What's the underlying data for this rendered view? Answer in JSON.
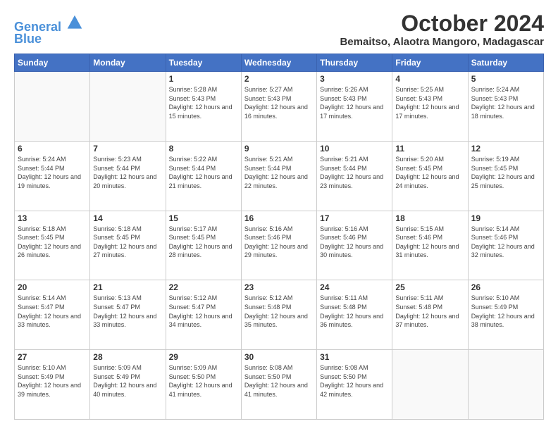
{
  "logo": {
    "line1": "General",
    "line2": "Blue"
  },
  "title": "October 2024",
  "subtitle": "Bemaitso, Alaotra Mangoro, Madagascar",
  "weekdays": [
    "Sunday",
    "Monday",
    "Tuesday",
    "Wednesday",
    "Thursday",
    "Friday",
    "Saturday"
  ],
  "weeks": [
    [
      null,
      null,
      {
        "day": "1",
        "sunrise": "5:28 AM",
        "sunset": "5:43 PM",
        "daylight": "12 hours and 15 minutes."
      },
      {
        "day": "2",
        "sunrise": "5:27 AM",
        "sunset": "5:43 PM",
        "daylight": "12 hours and 16 minutes."
      },
      {
        "day": "3",
        "sunrise": "5:26 AM",
        "sunset": "5:43 PM",
        "daylight": "12 hours and 17 minutes."
      },
      {
        "day": "4",
        "sunrise": "5:25 AM",
        "sunset": "5:43 PM",
        "daylight": "12 hours and 17 minutes."
      },
      {
        "day": "5",
        "sunrise": "5:24 AM",
        "sunset": "5:43 PM",
        "daylight": "12 hours and 18 minutes."
      }
    ],
    [
      {
        "day": "6",
        "sunrise": "5:24 AM",
        "sunset": "5:44 PM",
        "daylight": "12 hours and 19 minutes."
      },
      {
        "day": "7",
        "sunrise": "5:23 AM",
        "sunset": "5:44 PM",
        "daylight": "12 hours and 20 minutes."
      },
      {
        "day": "8",
        "sunrise": "5:22 AM",
        "sunset": "5:44 PM",
        "daylight": "12 hours and 21 minutes."
      },
      {
        "day": "9",
        "sunrise": "5:21 AM",
        "sunset": "5:44 PM",
        "daylight": "12 hours and 22 minutes."
      },
      {
        "day": "10",
        "sunrise": "5:21 AM",
        "sunset": "5:44 PM",
        "daylight": "12 hours and 23 minutes."
      },
      {
        "day": "11",
        "sunrise": "5:20 AM",
        "sunset": "5:45 PM",
        "daylight": "12 hours and 24 minutes."
      },
      {
        "day": "12",
        "sunrise": "5:19 AM",
        "sunset": "5:45 PM",
        "daylight": "12 hours and 25 minutes."
      }
    ],
    [
      {
        "day": "13",
        "sunrise": "5:18 AM",
        "sunset": "5:45 PM",
        "daylight": "12 hours and 26 minutes."
      },
      {
        "day": "14",
        "sunrise": "5:18 AM",
        "sunset": "5:45 PM",
        "daylight": "12 hours and 27 minutes."
      },
      {
        "day": "15",
        "sunrise": "5:17 AM",
        "sunset": "5:45 PM",
        "daylight": "12 hours and 28 minutes."
      },
      {
        "day": "16",
        "sunrise": "5:16 AM",
        "sunset": "5:46 PM",
        "daylight": "12 hours and 29 minutes."
      },
      {
        "day": "17",
        "sunrise": "5:16 AM",
        "sunset": "5:46 PM",
        "daylight": "12 hours and 30 minutes."
      },
      {
        "day": "18",
        "sunrise": "5:15 AM",
        "sunset": "5:46 PM",
        "daylight": "12 hours and 31 minutes."
      },
      {
        "day": "19",
        "sunrise": "5:14 AM",
        "sunset": "5:46 PM",
        "daylight": "12 hours and 32 minutes."
      }
    ],
    [
      {
        "day": "20",
        "sunrise": "5:14 AM",
        "sunset": "5:47 PM",
        "daylight": "12 hours and 33 minutes."
      },
      {
        "day": "21",
        "sunrise": "5:13 AM",
        "sunset": "5:47 PM",
        "daylight": "12 hours and 33 minutes."
      },
      {
        "day": "22",
        "sunrise": "5:12 AM",
        "sunset": "5:47 PM",
        "daylight": "12 hours and 34 minutes."
      },
      {
        "day": "23",
        "sunrise": "5:12 AM",
        "sunset": "5:48 PM",
        "daylight": "12 hours and 35 minutes."
      },
      {
        "day": "24",
        "sunrise": "5:11 AM",
        "sunset": "5:48 PM",
        "daylight": "12 hours and 36 minutes."
      },
      {
        "day": "25",
        "sunrise": "5:11 AM",
        "sunset": "5:48 PM",
        "daylight": "12 hours and 37 minutes."
      },
      {
        "day": "26",
        "sunrise": "5:10 AM",
        "sunset": "5:49 PM",
        "daylight": "12 hours and 38 minutes."
      }
    ],
    [
      {
        "day": "27",
        "sunrise": "5:10 AM",
        "sunset": "5:49 PM",
        "daylight": "12 hours and 39 minutes."
      },
      {
        "day": "28",
        "sunrise": "5:09 AM",
        "sunset": "5:49 PM",
        "daylight": "12 hours and 40 minutes."
      },
      {
        "day": "29",
        "sunrise": "5:09 AM",
        "sunset": "5:50 PM",
        "daylight": "12 hours and 41 minutes."
      },
      {
        "day": "30",
        "sunrise": "5:08 AM",
        "sunset": "5:50 PM",
        "daylight": "12 hours and 41 minutes."
      },
      {
        "day": "31",
        "sunrise": "5:08 AM",
        "sunset": "5:50 PM",
        "daylight": "12 hours and 42 minutes."
      },
      null,
      null
    ]
  ]
}
